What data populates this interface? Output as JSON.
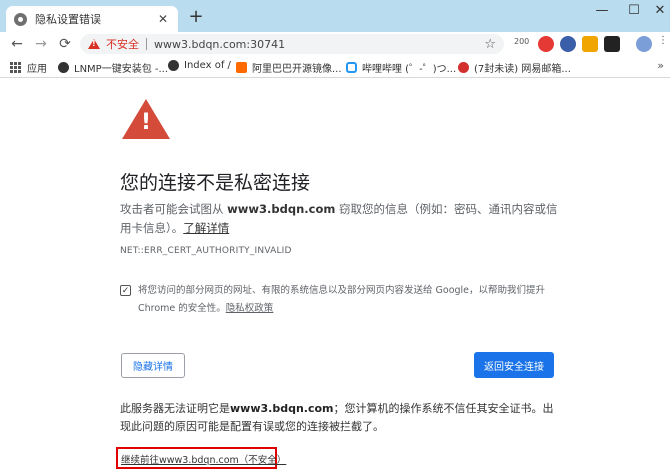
{
  "tab": {
    "title": "隐私设置错误",
    "close": "✕"
  },
  "window": {
    "new_tab": "+",
    "minimize": "—",
    "maximize": "☐",
    "close": "✕"
  },
  "toolbar": {
    "back": "←",
    "forward": "→",
    "reload": "⟳",
    "security_label": "不安全",
    "url": "www3.bdqn.com:30741",
    "star": "☆",
    "ext_badge": "200"
  },
  "bookmarks": [
    {
      "label": "应用"
    },
    {
      "label": "LNMP一键安装包 -..."
    },
    {
      "label": "Index of /"
    },
    {
      "label": "阿里巴巴开源镜像..."
    },
    {
      "label": "哔哩哔哩 (゜-゜)つ..."
    },
    {
      "label": "(7封未读) 网易邮箱..."
    }
  ],
  "bookmarks_more": "»",
  "content": {
    "warning_mark": "!",
    "heading": "您的连接不是私密连接",
    "para_pre": "攻击者可能会试图从 ",
    "para_host": "www3.bdqn.com",
    "para_post": " 窃取您的信息（例如：密码、通讯内容或信用卡信息）。",
    "learn_more": "了解详情",
    "error_code": "NET::ERR_CERT_AUTHORITY_INVALID",
    "checkbox_mark": "✓",
    "check_a": "将您访问的部分网页的网址、有限的系统信息以及部分网页内容发送给 Google，以帮助我们提升 Chrome 的安全性。",
    "privacy_link": "隐私权政策",
    "hide_details_button": "隐藏详情",
    "back_button": "返回安全连接",
    "details_pre": "此服务器无法证明它是",
    "details_host": "www3.bdqn.com",
    "details_post": "；您计算机的操作系统不信任其安全证书。出现此问题的原因可能是配置有误或您的连接被拦截了。",
    "proceed_link": "继续前往www3.bdqn.com（不安全）"
  },
  "colors": {
    "danger": "#d54b3a",
    "primary": "#1a73e8",
    "highlight_border": "#e00000"
  }
}
